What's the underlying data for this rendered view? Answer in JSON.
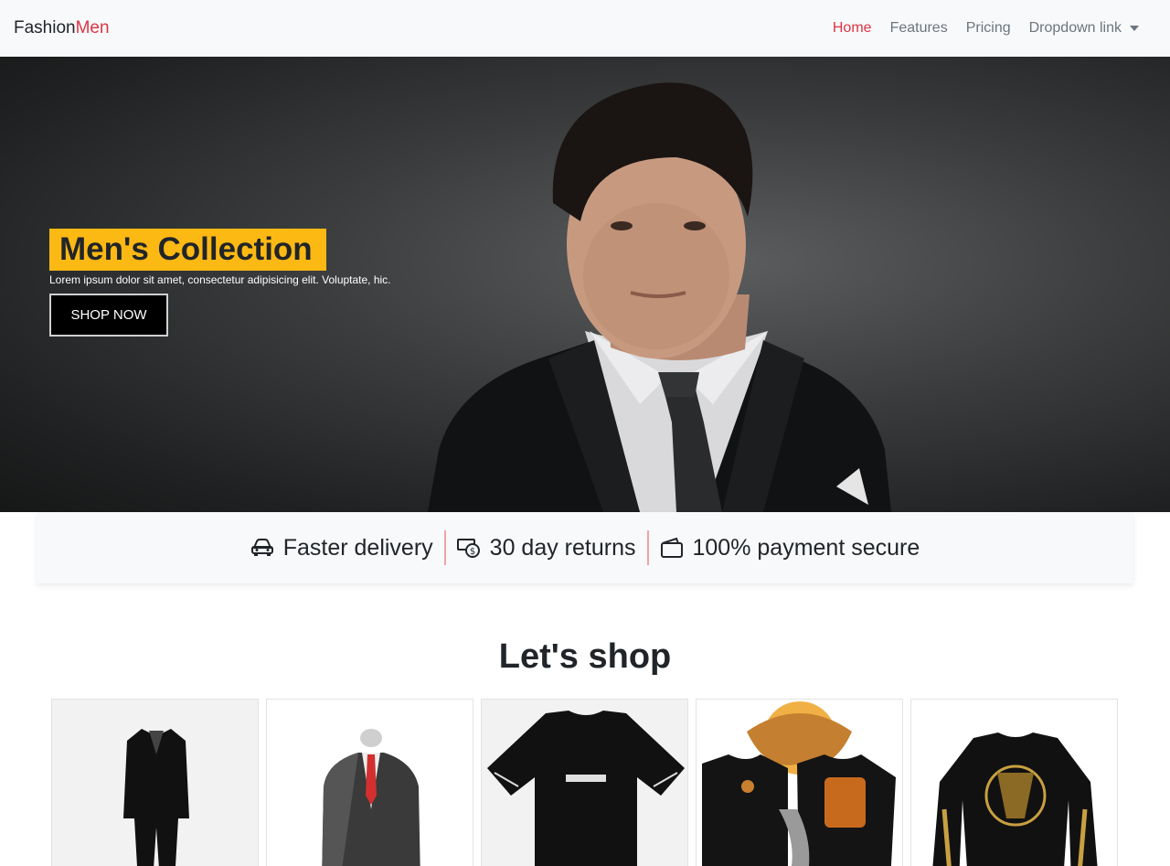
{
  "navbar": {
    "brand_main": "Fashion",
    "brand_accent": "Men",
    "links": [
      {
        "label": "Home",
        "active": true
      },
      {
        "label": "Features",
        "active": false
      },
      {
        "label": "Pricing",
        "active": false
      },
      {
        "label": "Dropdown link",
        "active": false
      }
    ]
  },
  "hero": {
    "title": "Men's Collection",
    "text": "Lorem ipsum dolor sit amet, consectetur adipisicing elit. Voluptate, hic.",
    "button_label": "SHOP NOW"
  },
  "features": [
    {
      "label": "Faster delivery",
      "icon": "car-icon"
    },
    {
      "label": "30 day returns",
      "icon": "money-icon"
    },
    {
      "label": "100% payment secure",
      "icon": "wallet-icon"
    }
  ],
  "shop": {
    "title": "Let's shop",
    "products": [
      {
        "icon": "black-suit-image"
      },
      {
        "icon": "grey-suit-red-tie-image"
      },
      {
        "icon": "black-tshirt-image"
      },
      {
        "icon": "printed-tshirts-image"
      },
      {
        "icon": "black-longsleeve-image"
      }
    ]
  },
  "colors": {
    "accent": "#dc3545",
    "highlight": "#fdb913",
    "navbar_bg": "#f8f9fa"
  }
}
